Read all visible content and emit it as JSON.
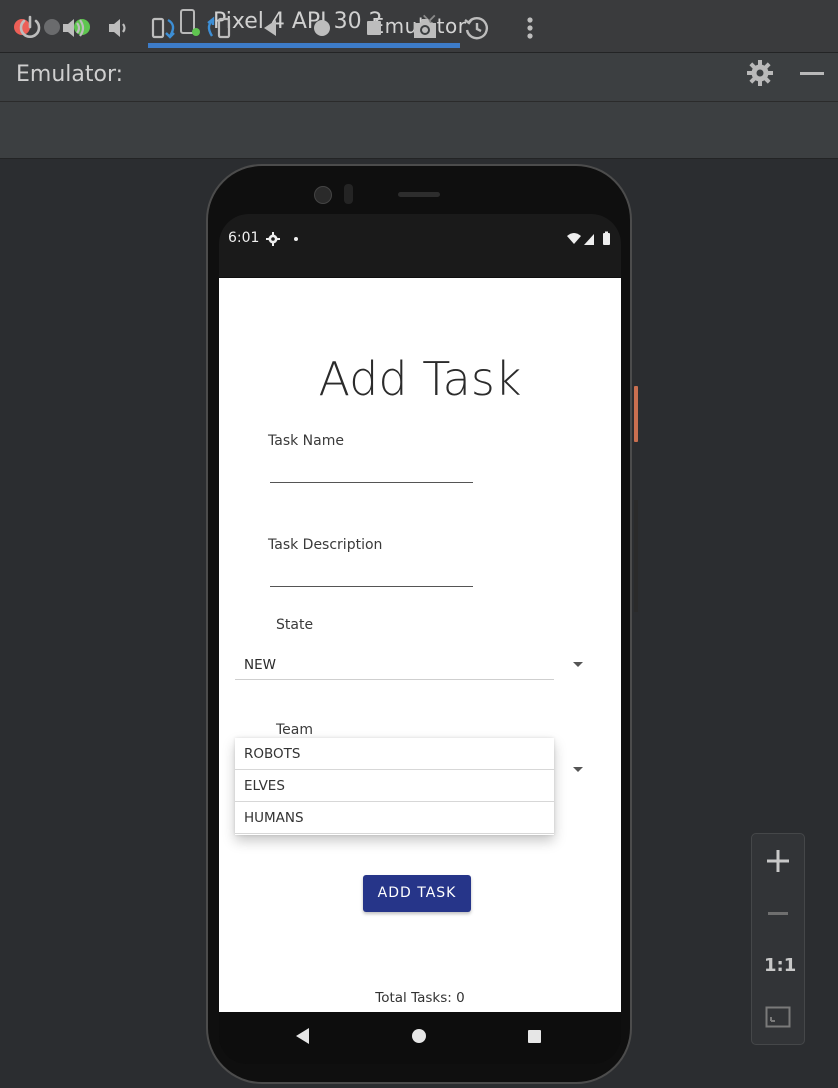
{
  "window": {
    "title": "Emulator"
  },
  "tabbar": {
    "label": "Emulator:",
    "device_tab": "Pixel 4 API 30 2",
    "close_glyph": "×"
  },
  "toolbar": {
    "buttons": [
      "power-icon",
      "volume-up-icon",
      "volume-down-icon",
      "rotate-left-icon",
      "rotate-right-icon",
      "back-icon",
      "home-icon",
      "overview-icon",
      "camera-icon",
      "snapshot-icon",
      "more-icon"
    ]
  },
  "status_bar": {
    "time": "6:01"
  },
  "app": {
    "title": "Add Task",
    "task_name_label": "Task Name",
    "task_description_label": "Task Description",
    "state_label": "State",
    "state_value": "NEW",
    "team_label": "Team",
    "team_options": [
      "ROBOTS",
      "ELVES",
      "HUMANS"
    ],
    "add_button": "ADD TASK",
    "total_tasks": "Total Tasks: 0"
  },
  "zoom": {
    "one_to_one": "1:1"
  },
  "colors": {
    "accent_tab": "#3d7cc9",
    "button": "#263589",
    "phone_side_button": "#c96f50"
  }
}
